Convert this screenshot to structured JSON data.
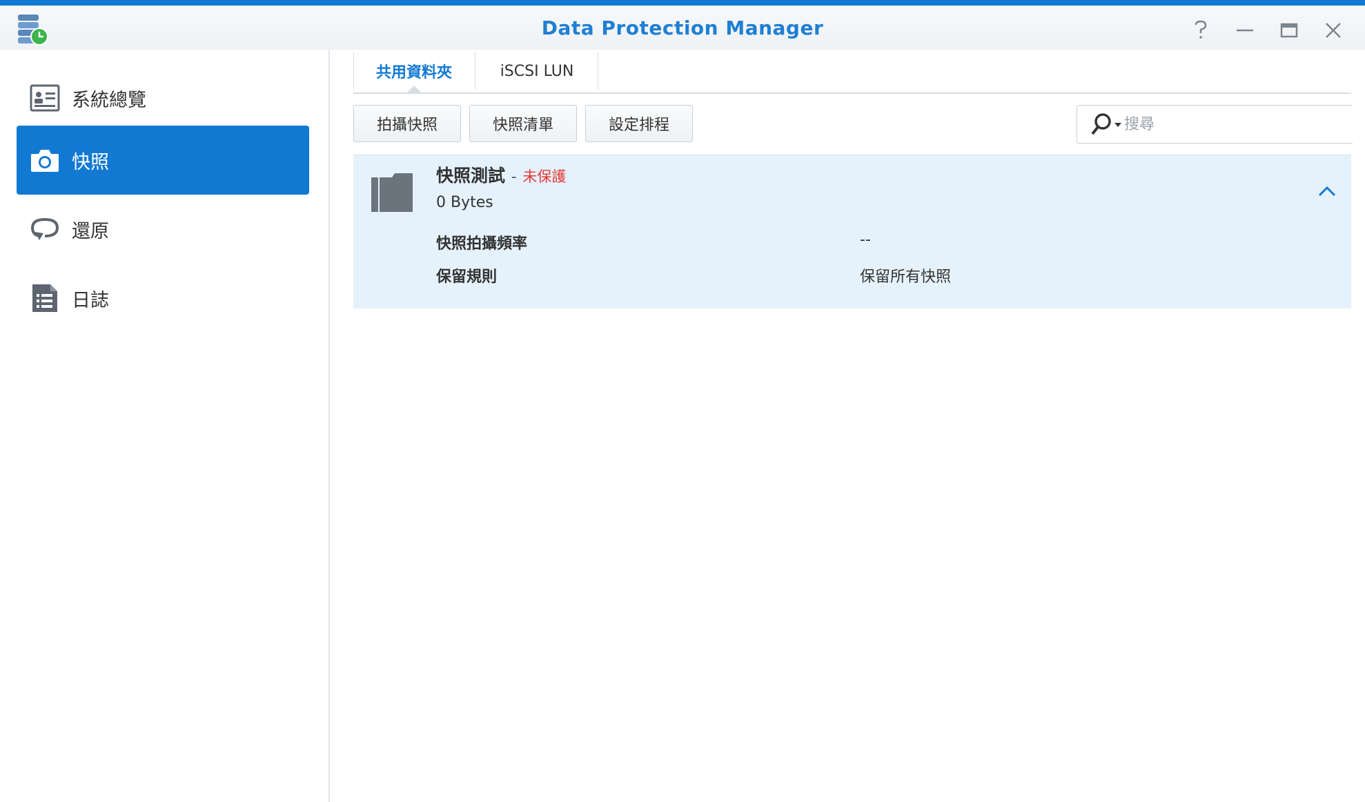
{
  "window": {
    "title": "Data Protection Manager",
    "accent_color": "#1279d3",
    "controls": [
      "help-icon",
      "minimize-icon",
      "maximize-icon",
      "close-icon"
    ]
  },
  "sidebar": {
    "items": [
      {
        "label": "系統總覽",
        "icon": "overview-icon",
        "active": false
      },
      {
        "label": "快照",
        "icon": "camera-icon",
        "active": true
      },
      {
        "label": "還原",
        "icon": "restore-icon",
        "active": false
      },
      {
        "label": "日誌",
        "icon": "log-icon",
        "active": false
      }
    ]
  },
  "tabs": [
    {
      "label": "共用資料夾",
      "active": true
    },
    {
      "label": "iSCSI LUN",
      "active": false
    }
  ],
  "toolbar": {
    "take_snapshot": "拍攝快照",
    "snapshot_list": "快照清單",
    "set_schedule": "設定排程"
  },
  "search": {
    "placeholder": "搜尋"
  },
  "item": {
    "name": "快照測試",
    "separator": "-",
    "status": "未保護",
    "size": "0 Bytes",
    "details": [
      {
        "label": "快照拍攝頻率",
        "value": "--"
      },
      {
        "label": "保留規則",
        "value": "保留所有快照"
      }
    ],
    "status_color": "#e53935"
  }
}
